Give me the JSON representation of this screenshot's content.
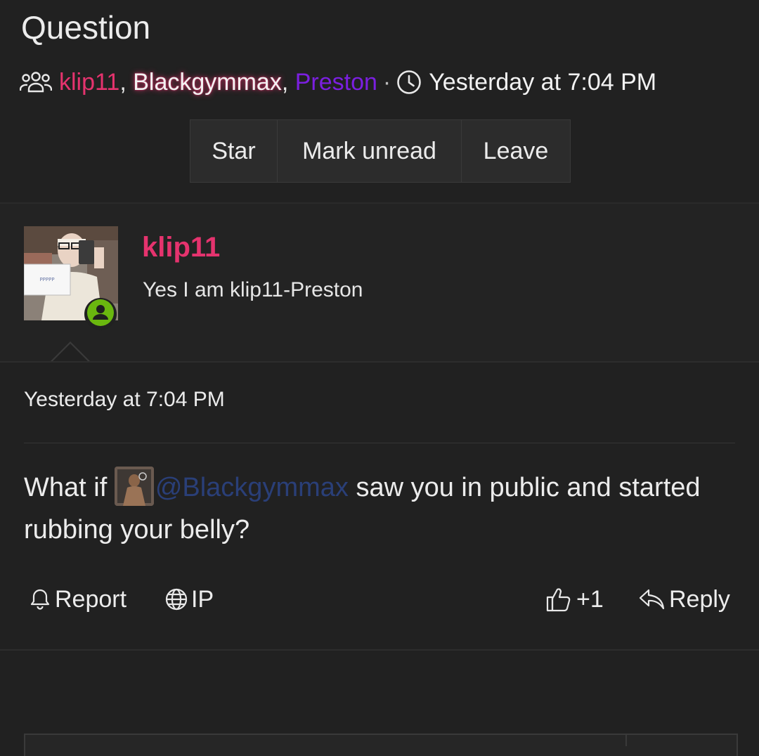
{
  "header": {
    "title": "Question",
    "participants": [
      {
        "name": "klip11",
        "sep": ", "
      },
      {
        "name": "Blackgymmax",
        "sep": ", "
      },
      {
        "name": "Preston",
        "sep": ""
      }
    ],
    "dot": "·",
    "timestamp": "Yesterday at 7:04 PM"
  },
  "toolbar": {
    "star_label": "Star",
    "mark_unread_label": "Mark unread",
    "leave_label": "Leave"
  },
  "message": {
    "username": "klip11",
    "user_title": "Yes I am klip11-Preston",
    "date": "Yesterday at 7:04 PM",
    "body_before": "What if ",
    "mention": "@Blackgymmax",
    "body_after": " saw you in public and started rubbing your belly?"
  },
  "actions": {
    "report_label": "Report",
    "ip_label": "IP",
    "like_label": "+1",
    "reply_label": "Reply"
  },
  "colors": {
    "background": "#212121",
    "username_pink": "#e5336e",
    "purple": "#7b1fe0",
    "mention_blue": "#2a3f78",
    "online_green": "#6ab70f"
  },
  "icons": {
    "participants": "users-icon",
    "time": "clock-icon",
    "report": "bell-icon",
    "ip": "globe-icon",
    "like": "thumbs-up-icon",
    "reply": "reply-icon",
    "status": "online-user-icon"
  }
}
